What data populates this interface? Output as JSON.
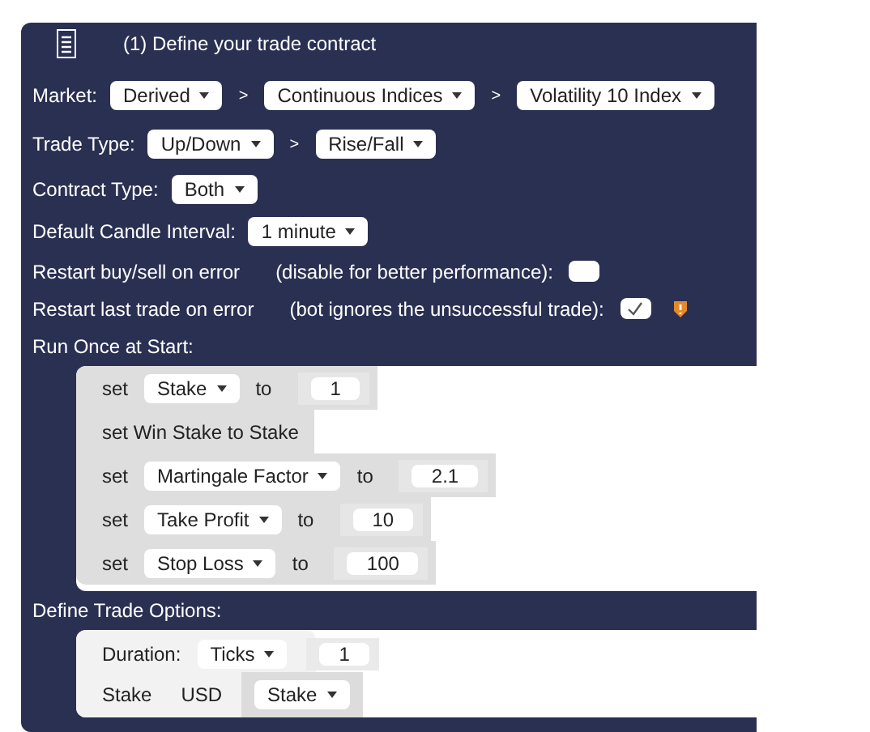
{
  "title": "(1) Define your trade contract",
  "rows": [
    {
      "kind": "fields",
      "label": "Market:",
      "items": [
        {
          "kind": "dropdown",
          "text": "Derived"
        },
        {
          "kind": "separator",
          "text": ">"
        },
        {
          "kind": "dropdown",
          "text": "Continuous Indices"
        },
        {
          "kind": "separator",
          "text": ">"
        },
        {
          "kind": "dropdown",
          "text": "Volatility 10 Index"
        }
      ]
    },
    {
      "kind": "fields",
      "label": "Trade Type:",
      "items": [
        {
          "kind": "dropdown",
          "text": "Up/Down"
        },
        {
          "kind": "separator",
          "text": ">"
        },
        {
          "kind": "dropdown",
          "text": "Rise/Fall"
        }
      ]
    },
    {
      "kind": "fields",
      "label": "Contract Type:",
      "items": [
        {
          "kind": "dropdown",
          "text": "Both"
        }
      ]
    },
    {
      "kind": "fields",
      "label": "Default Candle Interval:",
      "items": [
        {
          "kind": "dropdown",
          "text": "1 minute"
        }
      ]
    },
    {
      "kind": "checkbox",
      "label": "Restart buy/sell on error",
      "note": "(disable for better performance):",
      "checked": false,
      "warning": false
    },
    {
      "kind": "checkbox",
      "label": "Restart last trade on error",
      "note": "(bot ignores the unsuccessful trade):",
      "checked": true,
      "warning": true
    }
  ],
  "run_once": {
    "label": "Run Once at Start:",
    "blocks": [
      {
        "kind": "set",
        "keyword": "set",
        "variable": "Stake",
        "to": "to",
        "value": "1"
      },
      {
        "kind": "statement",
        "text": "set Win Stake to Stake"
      },
      {
        "kind": "set",
        "keyword": "set",
        "variable": "Martingale Factor",
        "to": "to",
        "value": "2.1"
      },
      {
        "kind": "set",
        "keyword": "set",
        "variable": "Take Profit",
        "to": "to",
        "value": "10"
      },
      {
        "kind": "set",
        "keyword": "set",
        "variable": "Stop Loss",
        "to": "to",
        "value": "100"
      }
    ]
  },
  "trade_options": {
    "label": "Define Trade Options:",
    "duration_label": "Duration:",
    "duration_unit": "Ticks",
    "duration_value": "1",
    "stake_label": "Stake",
    "currency": "USD",
    "stake_value": "Stake"
  }
}
